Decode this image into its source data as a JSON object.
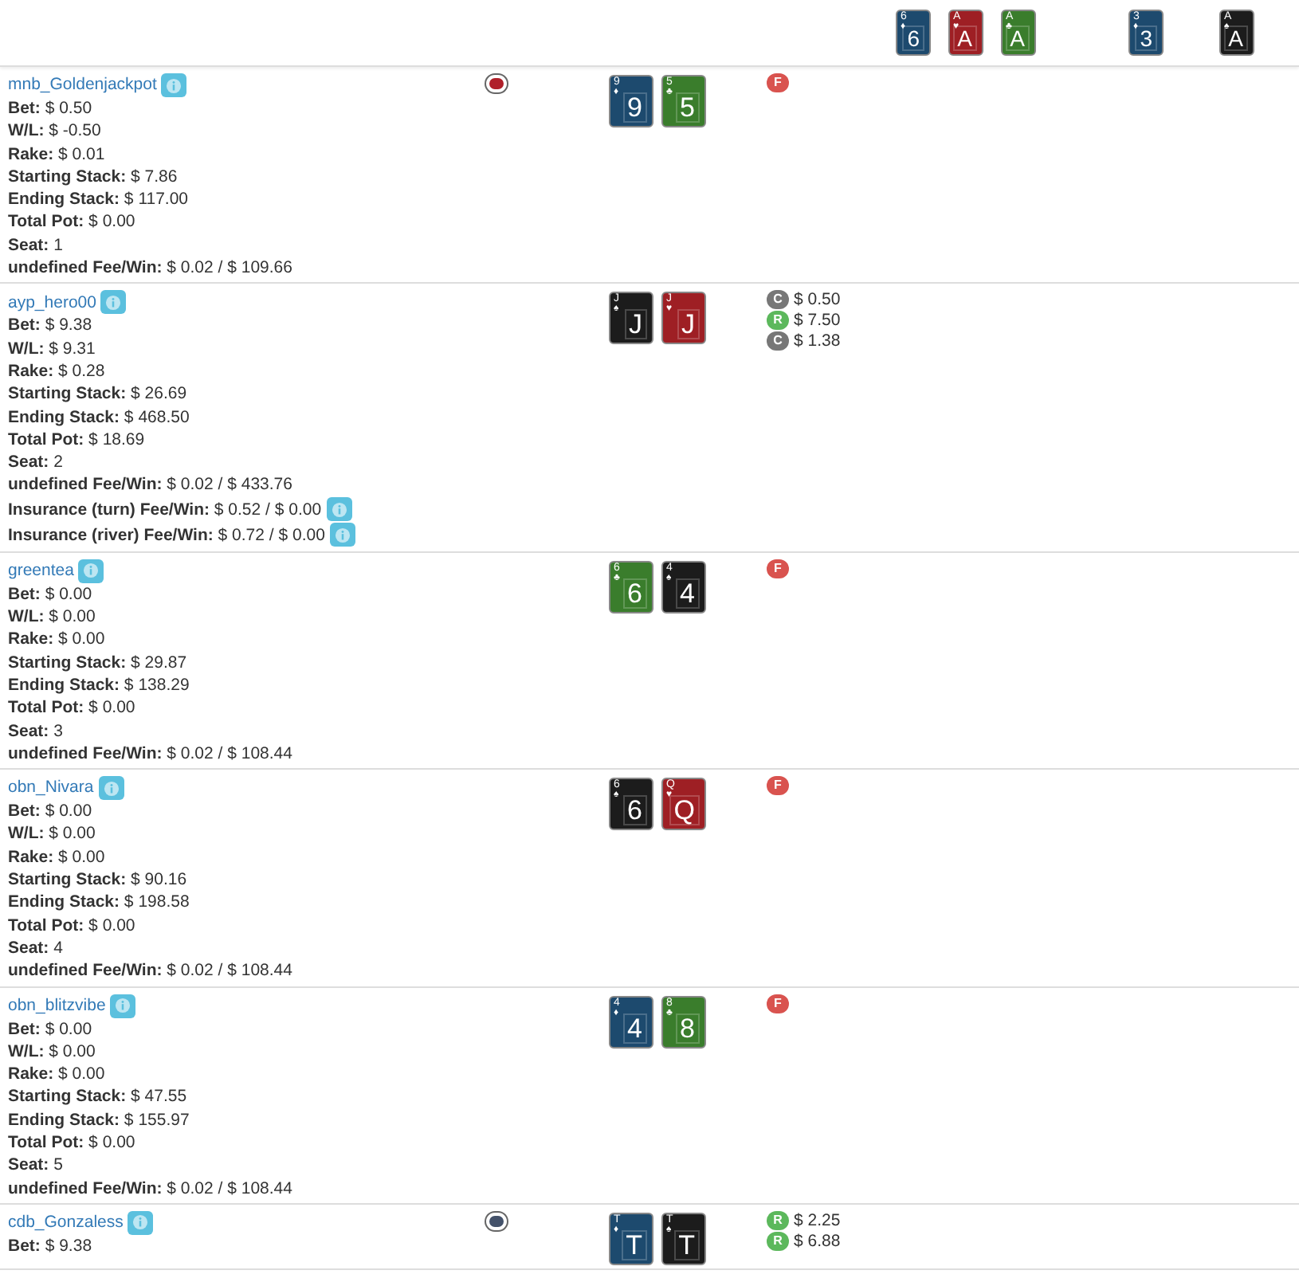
{
  "board": {
    "flop": [
      {
        "corner": "6",
        "suit": "♦",
        "rank": "6",
        "color": "#1d4a6e"
      },
      {
        "corner": "A",
        "suit": "♥",
        "rank": "A",
        "color": "#9e1f24"
      },
      {
        "corner": "A",
        "suit": "♣",
        "rank": "A",
        "color": "#3a7d2c"
      }
    ],
    "turn": [
      {
        "corner": "3",
        "suit": "♦",
        "rank": "3",
        "color": "#1d4a6e"
      }
    ],
    "river": [
      {
        "corner": "A",
        "suit": "♠",
        "rank": "A",
        "color": "#1c1c1c"
      }
    ]
  },
  "players": [
    {
      "name": "mnb_Goldenjackpot",
      "chip": {
        "color": "#b0202a"
      },
      "cards": [
        {
          "corner": "9",
          "suit": "♦",
          "rank": "9",
          "color": "#1d4a6e"
        },
        {
          "corner": "5",
          "suit": "♣",
          "rank": "5",
          "color": "#3a7d2c"
        }
      ],
      "actions": [
        {
          "badge": "F",
          "kind": "fold"
        }
      ],
      "lines": [
        {
          "label": "Bet:",
          "value": "$ 0.50"
        },
        {
          "label": "W/L:",
          "value": "$ -0.50"
        },
        {
          "label": "Rake:",
          "value": "$ 0.01"
        },
        {
          "label": "Starting Stack:",
          "value": "$ 7.86"
        },
        {
          "label": "Ending Stack:",
          "value": "$ 117.00"
        },
        {
          "label": "Total Pot:",
          "value": "$ 0.00"
        },
        {
          "label": "Seat:",
          "value": "1"
        },
        {
          "label": "undefined Fee/Win:",
          "value": "$ 0.02 / $ 109.66"
        }
      ]
    },
    {
      "name": "ayp_hero00",
      "cards": [
        {
          "corner": "J",
          "suit": "♠",
          "rank": "J",
          "color": "#1c1c1c"
        },
        {
          "corner": "J",
          "suit": "♥",
          "rank": "J",
          "color": "#9e1f24"
        }
      ],
      "actions": [
        {
          "badge": "C",
          "kind": "call",
          "amount": "$ 0.50"
        },
        {
          "badge": "R",
          "kind": "raise",
          "amount": "$ 7.50"
        },
        {
          "badge": "C",
          "kind": "call",
          "amount": "$ 1.38"
        }
      ],
      "lines": [
        {
          "label": "Bet:",
          "value": "$ 9.38"
        },
        {
          "label": "W/L:",
          "value": "$ 9.31"
        },
        {
          "label": "Rake:",
          "value": "$ 0.28"
        },
        {
          "label": "Starting Stack:",
          "value": "$ 26.69"
        },
        {
          "label": "Ending Stack:",
          "value": "$ 468.50"
        },
        {
          "label": "Total Pot:",
          "value": "$ 18.69"
        },
        {
          "label": "Seat:",
          "value": "2"
        },
        {
          "label": "undefined Fee/Win:",
          "value": "$ 0.02 / $ 433.76"
        },
        {
          "label": "Insurance (turn) Fee/Win:",
          "value": "$ 0.52 / $ 0.00",
          "info": true
        },
        {
          "label": "Insurance (river) Fee/Win:",
          "value": "$ 0.72 / $ 0.00",
          "info": true
        }
      ]
    },
    {
      "name": "greentea",
      "cards": [
        {
          "corner": "6",
          "suit": "♣",
          "rank": "6",
          "color": "#3a7d2c"
        },
        {
          "corner": "4",
          "suit": "♠",
          "rank": "4",
          "color": "#1c1c1c"
        }
      ],
      "actions": [
        {
          "badge": "F",
          "kind": "fold"
        }
      ],
      "lines": [
        {
          "label": "Bet:",
          "value": "$ 0.00"
        },
        {
          "label": "W/L:",
          "value": "$ 0.00"
        },
        {
          "label": "Rake:",
          "value": "$ 0.00"
        },
        {
          "label": "Starting Stack:",
          "value": "$ 29.87"
        },
        {
          "label": "Ending Stack:",
          "value": "$ 138.29"
        },
        {
          "label": "Total Pot:",
          "value": "$ 0.00"
        },
        {
          "label": "Seat:",
          "value": "3"
        },
        {
          "label": "undefined Fee/Win:",
          "value": "$ 0.02 / $ 108.44"
        }
      ]
    },
    {
      "name": "obn_Nivara",
      "cards": [
        {
          "corner": "6",
          "suit": "♠",
          "rank": "6",
          "color": "#1c1c1c"
        },
        {
          "corner": "Q",
          "suit": "♥",
          "rank": "Q",
          "color": "#9e1f24"
        }
      ],
      "actions": [
        {
          "badge": "F",
          "kind": "fold"
        }
      ],
      "lines": [
        {
          "label": "Bet:",
          "value": "$ 0.00"
        },
        {
          "label": "W/L:",
          "value": "$ 0.00"
        },
        {
          "label": "Rake:",
          "value": "$ 0.00"
        },
        {
          "label": "Starting Stack:",
          "value": "$ 90.16"
        },
        {
          "label": "Ending Stack:",
          "value": "$ 198.58"
        },
        {
          "label": "Total Pot:",
          "value": "$ 0.00"
        },
        {
          "label": "Seat:",
          "value": "4"
        },
        {
          "label": "undefined Fee/Win:",
          "value": "$ 0.02 / $ 108.44"
        }
      ]
    },
    {
      "name": "obn_blitzvibe",
      "cards": [
        {
          "corner": "4",
          "suit": "♦",
          "rank": "4",
          "color": "#1d4a6e"
        },
        {
          "corner": "8",
          "suit": "♣",
          "rank": "8",
          "color": "#3a7d2c"
        }
      ],
      "actions": [
        {
          "badge": "F",
          "kind": "fold"
        }
      ],
      "lines": [
        {
          "label": "Bet:",
          "value": "$ 0.00"
        },
        {
          "label": "W/L:",
          "value": "$ 0.00"
        },
        {
          "label": "Rake:",
          "value": "$ 0.00"
        },
        {
          "label": "Starting Stack:",
          "value": "$ 47.55"
        },
        {
          "label": "Ending Stack:",
          "value": "$ 155.97"
        },
        {
          "label": "Total Pot:",
          "value": "$ 0.00"
        },
        {
          "label": "Seat:",
          "value": "5"
        },
        {
          "label": "undefined Fee/Win:",
          "value": "$ 0.02 / $ 108.44"
        }
      ]
    },
    {
      "name": "cdb_Gonzaless",
      "chip": {
        "color": "#44526a"
      },
      "cards": [
        {
          "corner": "T",
          "suit": "♦",
          "rank": "T",
          "color": "#1d4a6e"
        },
        {
          "corner": "T",
          "suit": "♠",
          "rank": "T",
          "color": "#1c1c1c"
        }
      ],
      "actions": [
        {
          "badge": "R",
          "kind": "raise",
          "amount": "$ 2.25"
        },
        {
          "badge": "R",
          "kind": "raise",
          "amount": "$ 6.88"
        }
      ],
      "lines": [
        {
          "label": "Bet:",
          "value": "$ 9.38"
        }
      ]
    }
  ]
}
